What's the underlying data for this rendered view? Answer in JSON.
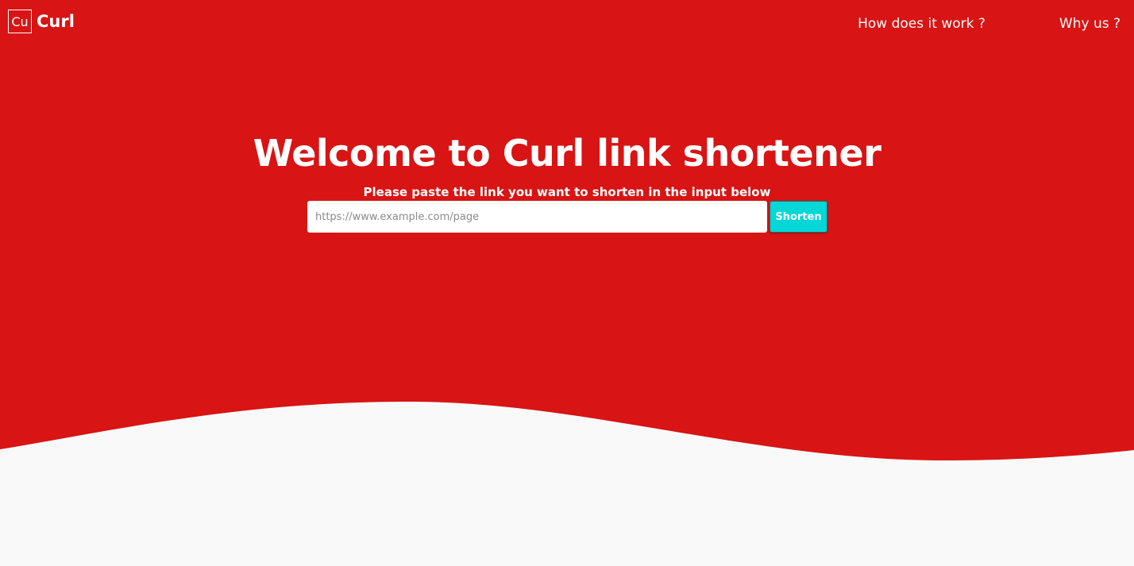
{
  "colors": {
    "brand_red": "#d81414",
    "page_background": "#f9f9f9",
    "button_teal": "#06d6d6"
  },
  "logo": {
    "mark": "Cu",
    "name": "Curl"
  },
  "nav": {
    "items": [
      {
        "label": "How does it work ?"
      },
      {
        "label": "Why us ?"
      }
    ]
  },
  "hero": {
    "title": "Welcome to Curl link shortener",
    "subtitle": "Please paste the link you want to shorten in the input below"
  },
  "form": {
    "input_value": "",
    "input_placeholder": "https://www.example.com/page",
    "button_label": "Shorten"
  }
}
